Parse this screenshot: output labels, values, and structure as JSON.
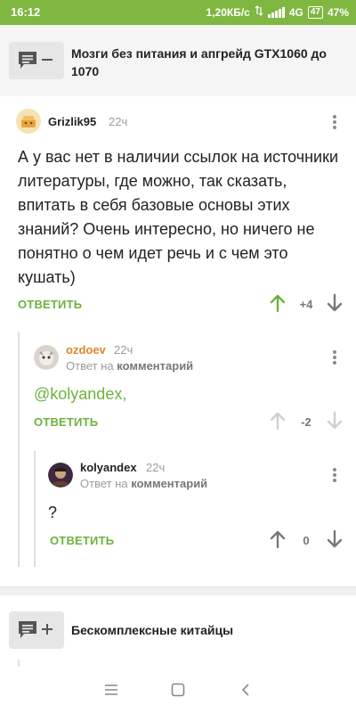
{
  "status_bar": {
    "time": "16:12",
    "speed": "1,20КБ/с",
    "network": "4G",
    "battery_level": "47",
    "battery_percent": "47%"
  },
  "posts": [
    {
      "title": "Мозги без питания и апгрейд GTX1060 до 1070"
    },
    {
      "title": "Бескомплексные китайцы"
    }
  ],
  "comments": [
    {
      "username": "Grizlik95",
      "time": "22ч",
      "text": "А у вас нет в наличии ссылок на источники литературы, где можно, так сказать, впитать в себя базовые основы этих знаний? Очень интересно, но ничего не понятно о чем идет речь и с чем это кушать)",
      "reply_label": "ОТВЕТИТЬ",
      "rating": "+4",
      "username_color": "#222222"
    },
    {
      "username": "ozdoev",
      "time": "22ч",
      "reply_prefix": "Ответ на",
      "reply_target": "комментарий",
      "text": "@kolyandex,",
      "reply_label": "ОТВЕТИТЬ",
      "rating": "-2",
      "username_color": "#e0862b"
    },
    {
      "username": "kolyandex",
      "time": "22ч",
      "reply_prefix": "Ответ на",
      "reply_target": "комментарий",
      "text": "?",
      "reply_label": "ОТВЕТИТЬ",
      "rating": "0",
      "username_color": "#222222"
    }
  ],
  "icons": {
    "post_collapse": "comment-minus-icon",
    "post_expand": "comment-plus-icon",
    "vote_up": "arrow-up-icon",
    "vote_down": "arrow-down-icon",
    "more": "kebab-menu-icon",
    "nav_menu": "menu-icon",
    "nav_home": "home-square-icon",
    "nav_back": "back-chevron-icon"
  },
  "colors": {
    "status_bar": "#7fb741",
    "accent_green": "#6cb33e",
    "upvoted": "#6cb33e",
    "username_orange": "#e0862b"
  }
}
